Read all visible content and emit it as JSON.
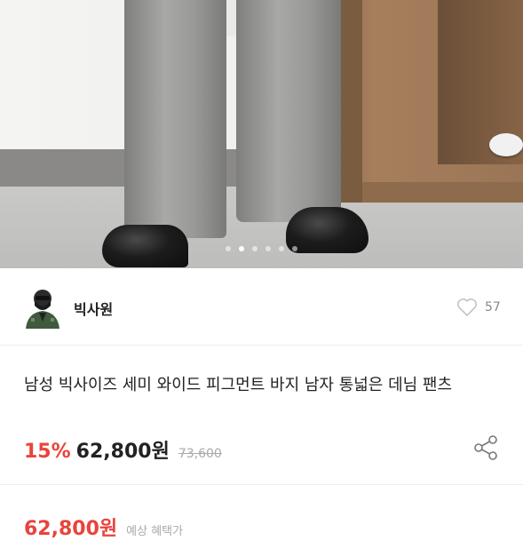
{
  "gallery": {
    "slide_count": 6,
    "active_index": 1
  },
  "seller": {
    "name": "빅사원",
    "likes": "57"
  },
  "product": {
    "title": "남성 빅사이즈 세미 와이드 피그먼트 바지 남자 통넓은 데님 팬츠",
    "discount": "15%",
    "price": "62,800원",
    "original_price": "73,600"
  },
  "bottom": {
    "price": "62,800원",
    "note": "예상 혜택가"
  },
  "colors": {
    "accent": "#e8443b",
    "text": "#222222",
    "muted": "#aaaaaa"
  },
  "icons": {
    "like": "heart-outline-icon",
    "share": "share-icon"
  }
}
